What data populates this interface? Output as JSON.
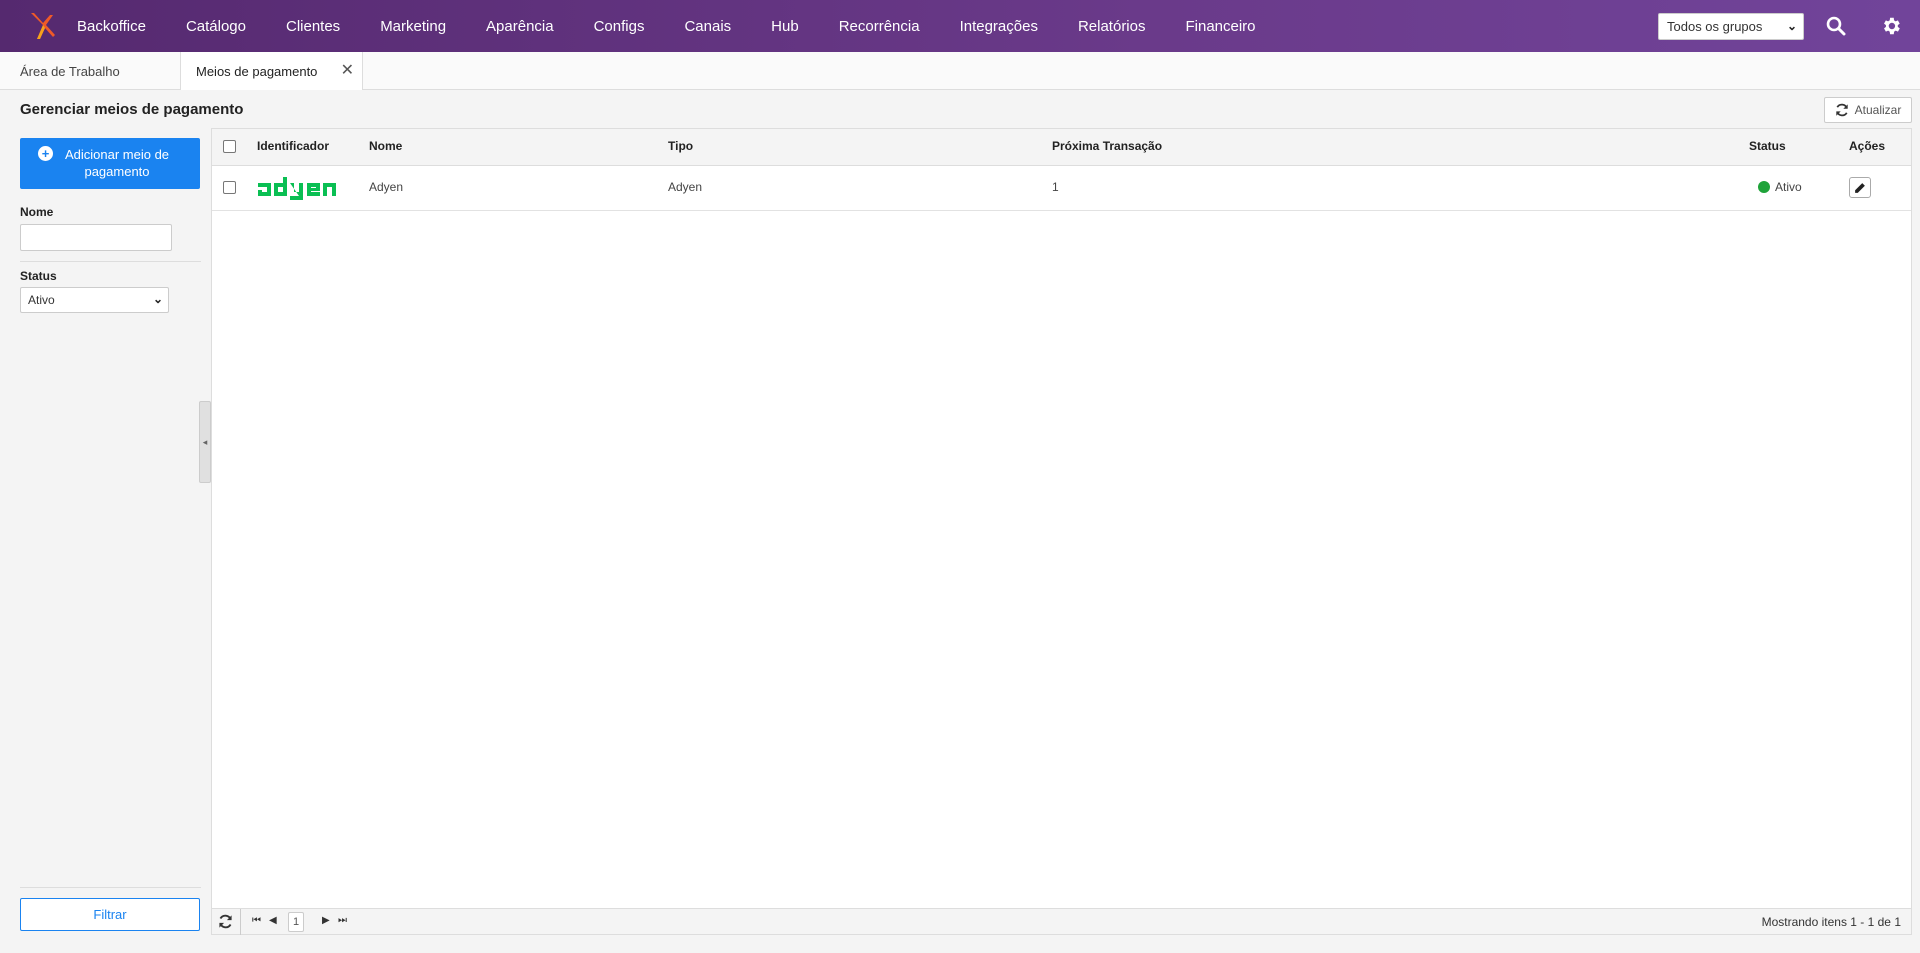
{
  "nav": {
    "items": [
      "Backoffice",
      "Catálogo",
      "Clientes",
      "Marketing",
      "Aparência",
      "Configs",
      "Canais",
      "Hub",
      "Recorrência",
      "Integrações",
      "Relatórios",
      "Financeiro"
    ],
    "group_select": "Todos os grupos",
    "search_icon": "search-icon",
    "settings_icon": "gear-icon",
    "brand_color": "#5b2d7a"
  },
  "tabs": {
    "workspace": "Área de Trabalho",
    "payment": "Meios de pagamento",
    "close": "✕"
  },
  "page": {
    "title": "Gerenciar meios de pagamento",
    "refresh": "Atualizar"
  },
  "sidebar": {
    "add_button": "Adicionar meio de pagamento",
    "name_label": "Nome",
    "name_value": "",
    "status_label": "Status",
    "status_value": "Ativo",
    "filter": "Filtrar",
    "accent": "#1a83f0"
  },
  "grid": {
    "headers": {
      "identifier": "Identificador",
      "name": "Nome",
      "type": "Tipo",
      "next": "Próxima Transação",
      "status": "Status",
      "actions": "Ações"
    },
    "rows": [
      {
        "logo": "adyen",
        "name": "Adyen",
        "type": "Adyen",
        "next": "1",
        "status": "Ativo",
        "status_color": "#1fa33a",
        "logo_color": "#0abf53"
      }
    ]
  },
  "pager": {
    "page": "1",
    "info": "Mostrando itens 1 - 1 de 1"
  }
}
